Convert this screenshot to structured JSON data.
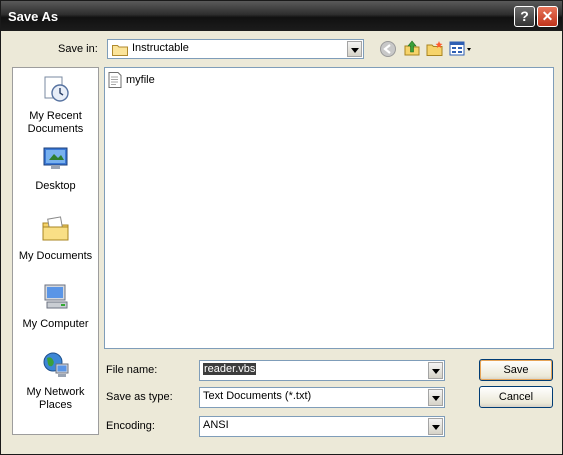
{
  "window": {
    "title": "Save As"
  },
  "toolbar": {
    "save_in_label": "Save in:",
    "save_in_value": "Instructable"
  },
  "places": [
    {
      "label": "My Recent Documents",
      "icon": "recent-documents-icon"
    },
    {
      "label": "Desktop",
      "icon": "desktop-icon"
    },
    {
      "label": "My Documents",
      "icon": "my-documents-icon"
    },
    {
      "label": "My Computer",
      "icon": "my-computer-icon"
    },
    {
      "label": "My Network Places",
      "icon": "network-places-icon"
    }
  ],
  "files": [
    {
      "name": "myfile",
      "icon": "text-file-icon"
    }
  ],
  "form": {
    "file_name_label": "File name:",
    "file_name_value": "reader.vbs",
    "save_type_label": "Save as type:",
    "save_type_value": "Text Documents (*.txt)",
    "encoding_label": "Encoding:",
    "encoding_value": "ANSI"
  },
  "buttons": {
    "save": "Save",
    "cancel": "Cancel"
  }
}
